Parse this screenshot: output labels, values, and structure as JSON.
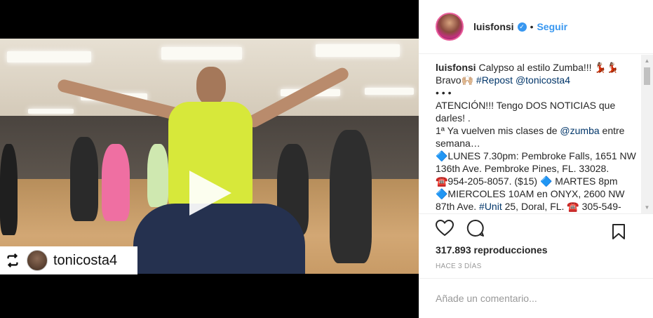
{
  "post": {
    "username": "luisfonsi",
    "follow_label": "Seguir",
    "separator": "•"
  },
  "repost": {
    "username": "tonicosta4"
  },
  "caption": {
    "author": "luisfonsi",
    "line1": "Calypso al estilo Zumba!!! 💃🏽💃🏽",
    "line2_prefix": "Bravo🙌🏼",
    "line2_hashtag": "#Repost",
    "line2_mention": "@tonicosta4",
    "dots": "• • •",
    "l3": "ATENCIÓN!!! Tengo DOS NOTICIAS que darles! .",
    "l4_prefix": "1ª Ya vuelven mis clases de",
    "l4_mention": "@zumba",
    "l4_suffix": "entre semana…",
    "l5": "🔷LUNES 7.30pm: Pembroke Falls, 1651 NW 136th Ave. Pembroke Pines, FL. 33028. ☎️954-205-8057. ($15) 🔷 MARTES 8pm 🔷MIERCOLES 10AM en ONYX, 2600 NW 87th Ave.",
    "l5_hashtag": "#Unit",
    "l5_suffix": "25, Doral, FL. ☎️ 305-549-"
  },
  "stats": {
    "views_count": "317.893",
    "views_label": "reproducciones",
    "time_ago": "HACE 3 DÍAS"
  },
  "comment": {
    "placeholder": "Añade un comentario..."
  },
  "icons": {
    "like": "heart-icon",
    "comment": "comment-icon",
    "save": "bookmark-icon",
    "play": "play-icon",
    "repost": "repost-icon",
    "verified": "verified-badge-icon"
  },
  "colors": {
    "accent": "#3897f0",
    "shirt": "#d7e83a",
    "text": "#262626",
    "muted": "#999999"
  }
}
